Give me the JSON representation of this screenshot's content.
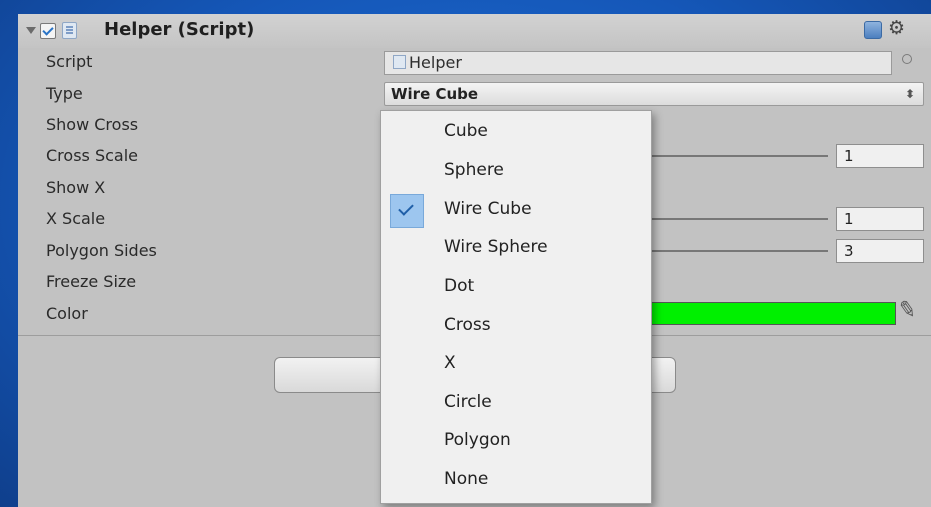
{
  "component": {
    "title": "Helper (Script)",
    "enabled": true
  },
  "fields": {
    "script_label": "Script",
    "script_value": "Helper",
    "type_label": "Type",
    "type_value": "Wire Cube",
    "show_cross_label": "Show Cross",
    "cross_scale_label": "Cross Scale",
    "cross_scale_value": "1",
    "show_x_label": "Show X",
    "x_scale_label": "X Scale",
    "x_scale_value": "1",
    "polygon_sides_label": "Polygon Sides",
    "polygon_sides_value": "3",
    "freeze_size_label": "Freeze Size",
    "color_label": "Color",
    "color_hex": "#00f000"
  },
  "dropdown": {
    "selected": "Wire Cube",
    "options": [
      "Cube",
      "Sphere",
      "Wire Cube",
      "Wire Sphere",
      "Dot",
      "Cross",
      "X",
      "Circle",
      "Polygon",
      "None"
    ]
  },
  "icons": {
    "foldout": "foldout-arrow-icon",
    "enable_checkbox": "checkbox-icon",
    "script": "script-file-icon",
    "help": "help-book-icon",
    "settings": "gear-icon",
    "object_picker": "object-picker-icon",
    "popup": "popup-arrows-icon",
    "eyedropper": "eyedropper-icon",
    "checkmark": "checkmark-icon"
  },
  "colors": {
    "background": "#1557b8",
    "panel": "#c2c2c2",
    "selection": "#9dc6ef"
  }
}
